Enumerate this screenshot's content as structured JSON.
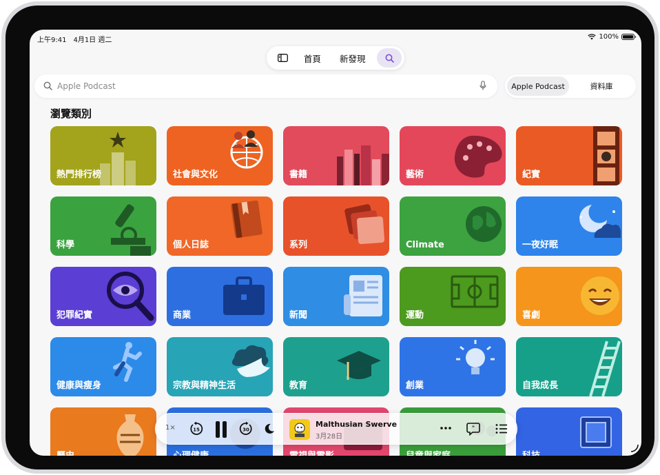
{
  "status": {
    "time": "上午9:41　4月1日 週二",
    "battery": "100%"
  },
  "tabbar": {
    "home": "首頁",
    "new": "新發現"
  },
  "search": {
    "placeholder": "Apple Podcast"
  },
  "scope": {
    "apple": "Apple Podcast",
    "library": "資料庫"
  },
  "section_title": "瀏覽類別",
  "categories": [
    {
      "label": "熱門排行榜",
      "color": "#a3a31c",
      "icon": "podium-star-icon"
    },
    {
      "label": "社會與文化",
      "color": "#ee6321",
      "icon": "people-globe-icon"
    },
    {
      "label": "書籍",
      "color": "#e24b5b",
      "icon": "books-icon"
    },
    {
      "label": "藝術",
      "color": "#e4475a",
      "icon": "palette-icon"
    },
    {
      "label": "紀實",
      "color": "#ea5a24",
      "icon": "film-strip-icon"
    },
    {
      "label": "科學",
      "color": "#3aa33f",
      "icon": "microscope-icon"
    },
    {
      "label": "個人日誌",
      "color": "#f06728",
      "icon": "journal-icon"
    },
    {
      "label": "系列",
      "color": "#e8522a",
      "icon": "stacked-cards-icon"
    },
    {
      "label": "Climate",
      "color": "#3da240",
      "icon": "earth-icon"
    },
    {
      "label": "一夜好眠",
      "color": "#2e84ea",
      "icon": "moon-clouds-icon"
    },
    {
      "label": "犯罪紀實",
      "color": "#5b3ed4",
      "icon": "magnifier-eye-icon"
    },
    {
      "label": "商業",
      "color": "#2d6fe0",
      "icon": "briefcase-icon"
    },
    {
      "label": "新聞",
      "color": "#2f8de4",
      "icon": "newspaper-icon"
    },
    {
      "label": "運動",
      "color": "#4c9a1e",
      "icon": "field-icon"
    },
    {
      "label": "喜劇",
      "color": "#f5951c",
      "icon": "laughing-face-icon"
    },
    {
      "label": "健康與瘦身",
      "color": "#2c8be9",
      "icon": "runner-icon"
    },
    {
      "label": "宗教與精神生活",
      "color": "#27a4b6",
      "icon": "dove-cloud-icon"
    },
    {
      "label": "教育",
      "color": "#1ea08e",
      "icon": "graduation-cap-icon"
    },
    {
      "label": "創業",
      "color": "#2f74e6",
      "icon": "lightbulb-icon"
    },
    {
      "label": "自我成長",
      "color": "#16a08a",
      "icon": "ladder-icon"
    },
    {
      "label": "歷史",
      "color": "#ea7a1e",
      "icon": "amphora-icon"
    },
    {
      "label": "心理健康",
      "color": "#2b6fe0",
      "icon": "mind-icon"
    },
    {
      "label": "電視與電影",
      "color": "#e3476d",
      "icon": "tv-icon"
    },
    {
      "label": "兒童與家庭",
      "color": "#3a9d3a",
      "icon": "family-icon"
    },
    {
      "label": "科技",
      "color": "#3264e4",
      "icon": "chip-icon"
    }
  ],
  "player": {
    "speed": "1×",
    "skip_back": "15",
    "skip_forward": "30",
    "title": "Malthusian Swerve",
    "date": "3月28日"
  }
}
